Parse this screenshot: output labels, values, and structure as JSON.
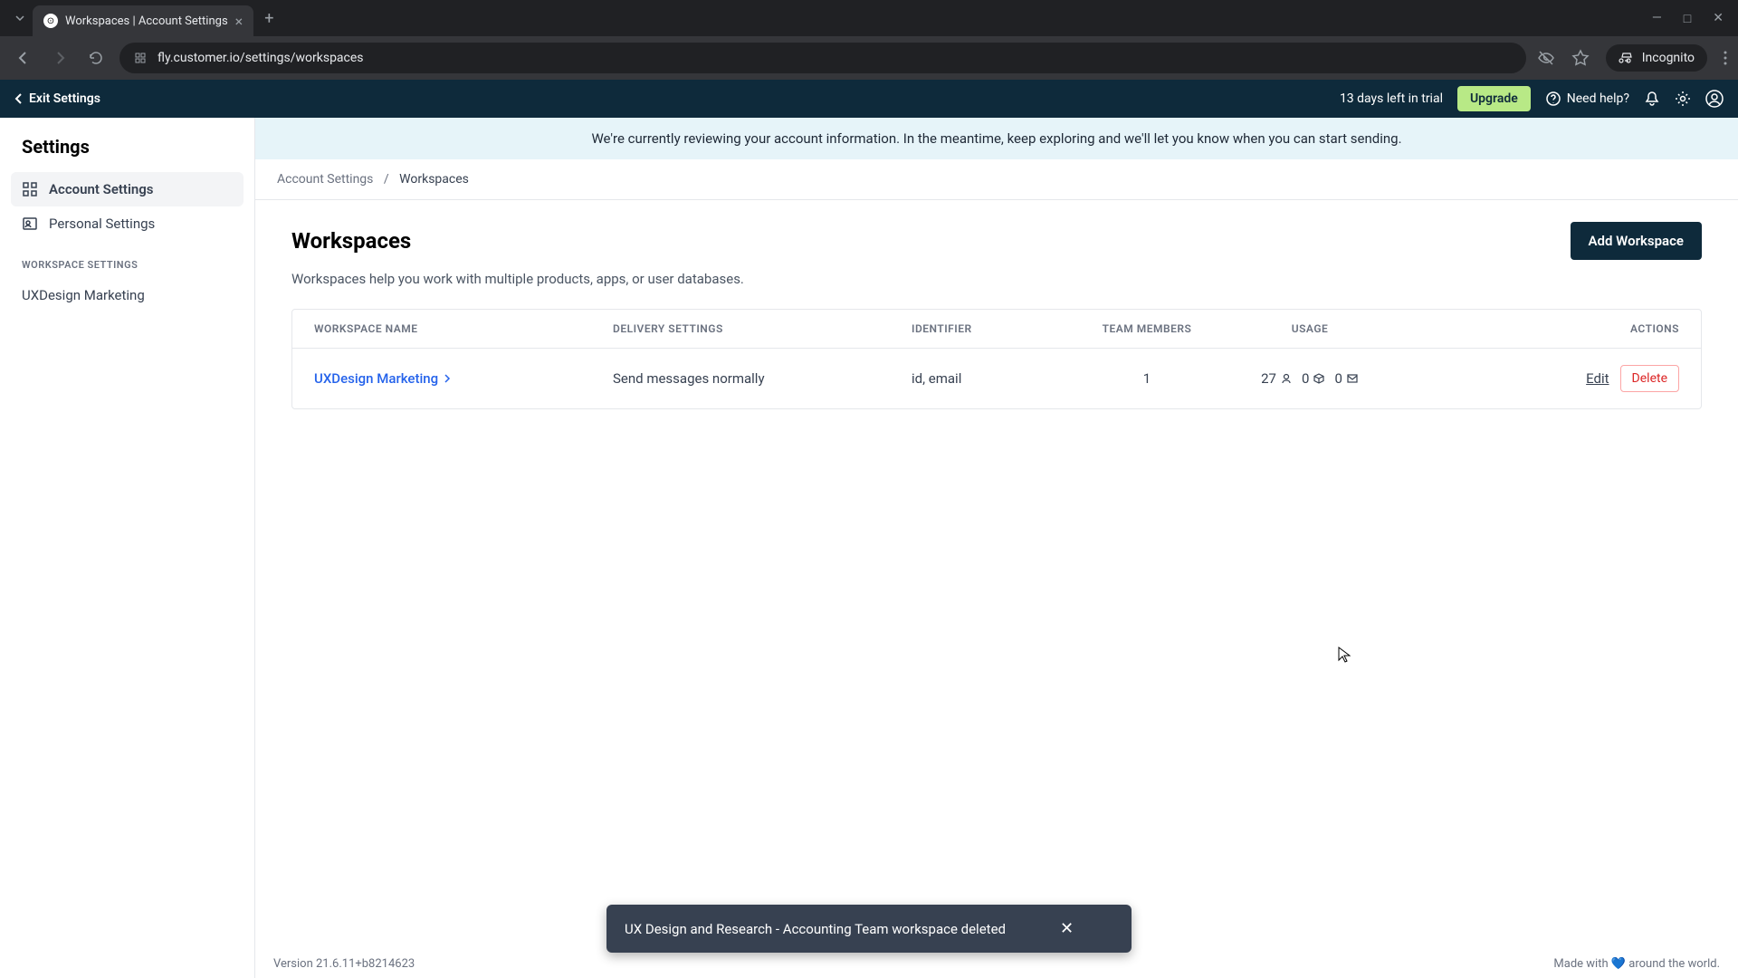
{
  "browser": {
    "tab_title": "Workspaces | Account Settings",
    "url": "fly.customer.io/settings/workspaces",
    "incognito_label": "Incognito"
  },
  "header": {
    "exit_label": "Exit Settings",
    "trial_text": "13 days left in trial",
    "upgrade_label": "Upgrade",
    "need_help_label": "Need help?"
  },
  "sidebar": {
    "title": "Settings",
    "account_settings": "Account Settings",
    "personal_settings": "Personal Settings",
    "section_header": "WORKSPACE SETTINGS",
    "workspace_item": "UXDesign Marketing"
  },
  "banner": {
    "text": "We're currently reviewing your account information. In the meantime, keep exploring and we'll let you know when you can start sending."
  },
  "breadcrumb": {
    "parent": "Account Settings",
    "current": "Workspaces"
  },
  "page": {
    "title": "Workspaces",
    "add_button": "Add Workspace",
    "description": "Workspaces help you work with multiple products, apps, or user databases."
  },
  "table": {
    "headers": {
      "name": "WORKSPACE NAME",
      "delivery": "DELIVERY SETTINGS",
      "identifier": "IDENTIFIER",
      "members": "TEAM MEMBERS",
      "usage": "USAGE",
      "actions": "ACTIONS"
    },
    "rows": [
      {
        "name": "UXDesign Marketing",
        "delivery": "Send messages normally",
        "identifier": "id, email",
        "members": "1",
        "usage_people": "27",
        "usage_objects": "0",
        "usage_messages": "0",
        "edit": "Edit",
        "delete": "Delete"
      }
    ]
  },
  "footer": {
    "version": "Version 21.6.11+b8214623",
    "made_with_prefix": "Made with ",
    "made_with_suffix": " around the world."
  },
  "toast": {
    "message": "UX Design and Research - Accounting Team workspace deleted"
  }
}
